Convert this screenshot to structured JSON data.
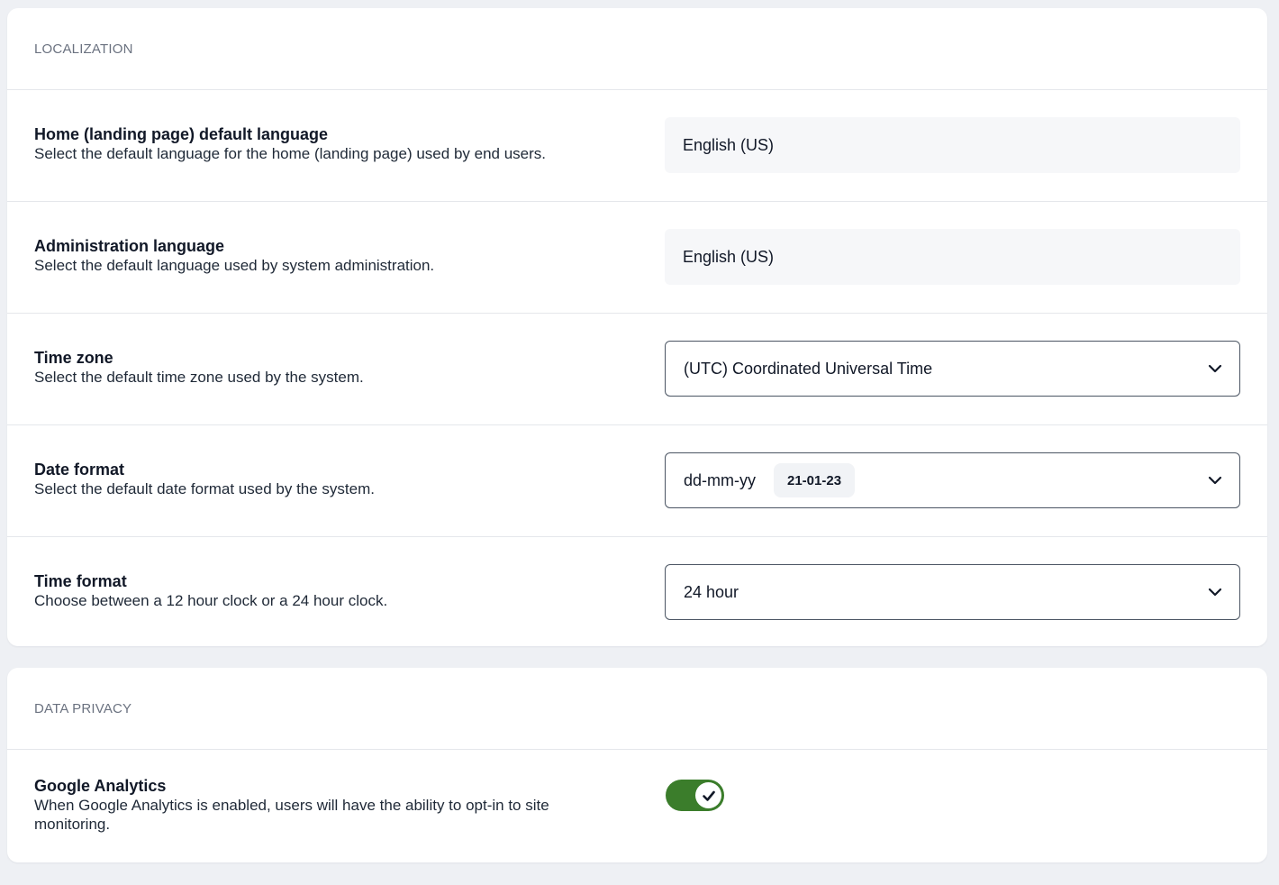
{
  "localization": {
    "header": "LOCALIZATION",
    "home_language": {
      "title": "Home (landing page) default language",
      "description": "Select the default language for the home (landing page) used by end users.",
      "value": "English (US)"
    },
    "admin_language": {
      "title": "Administration language",
      "description": "Select the default language used by system administration.",
      "value": "English (US)"
    },
    "time_zone": {
      "title": "Time zone",
      "description": "Select the default time zone used by the system.",
      "value": "(UTC) Coordinated Universal Time",
      "icon": "chevron-down-icon"
    },
    "date_format": {
      "title": "Date format",
      "description": "Select the default date format used by the system.",
      "value": "dd-mm-yy",
      "example": "21-01-23",
      "icon": "chevron-down-icon"
    },
    "time_format": {
      "title": "Time format",
      "description": "Choose between a 12 hour clock or a 24 hour clock.",
      "value": "24 hour",
      "icon": "chevron-down-icon"
    }
  },
  "data_privacy": {
    "header": "DATA PRIVACY",
    "google_analytics": {
      "title": "Google Analytics",
      "description": "When Google Analytics is enabled, users will have the ability to opt-in to site monitoring.",
      "enabled": true,
      "toggle_color": "#3b7d2b",
      "icon": "check-icon"
    }
  }
}
